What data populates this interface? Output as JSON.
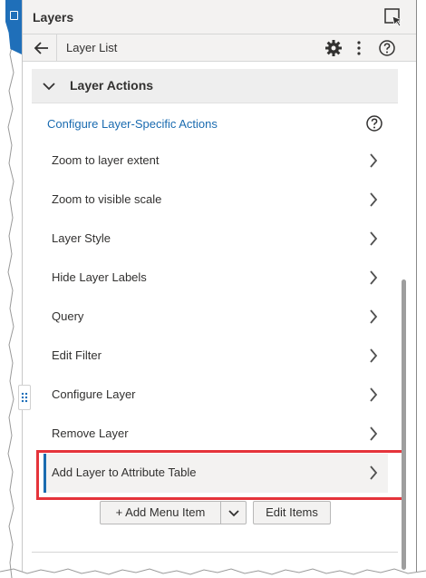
{
  "panel": {
    "title": "Layers",
    "select_icon": "select-icon"
  },
  "subheader": {
    "back_icon": "back-arrow-icon",
    "title": "Layer List",
    "gear_icon": "gear-icon",
    "more_icon": "more-options-icon",
    "help_icon": "help-icon"
  },
  "section": {
    "label": "Layer Actions",
    "chevron_icon": "chevron-down-icon"
  },
  "configure": {
    "link_text": "Configure Layer-Specific Actions",
    "help_icon": "help-icon"
  },
  "actions": [
    {
      "label": "Zoom to layer extent"
    },
    {
      "label": "Zoom to visible scale"
    },
    {
      "label": "Layer Style"
    },
    {
      "label": "Hide Layer Labels"
    },
    {
      "label": "Query"
    },
    {
      "label": "Edit Filter"
    },
    {
      "label": "Configure Layer"
    },
    {
      "label": "Remove Layer"
    },
    {
      "label": "Add Layer to Attribute Table",
      "selected": true
    }
  ],
  "buttons": {
    "add_menu_item": "+ Add Menu Item",
    "dropdown_icon": "chevron-down-icon",
    "edit_items": "Edit Items"
  },
  "colors": {
    "accent": "#1a6bb0",
    "highlight": "#e5343b",
    "header_bg": "#f3f2f1"
  }
}
